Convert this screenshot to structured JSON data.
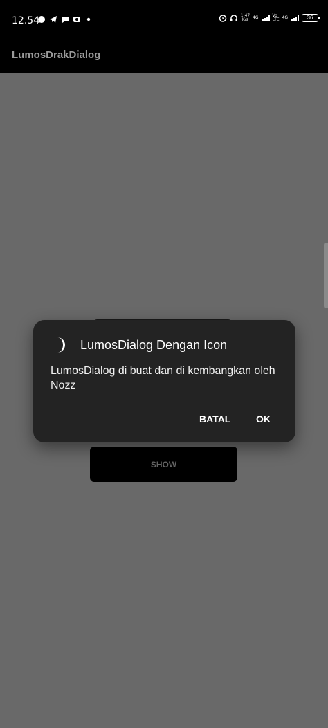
{
  "status_bar": {
    "time": "12.54",
    "net_speed_value": "1,47",
    "net_speed_unit": "K/s",
    "net_type_1": "4G",
    "volte_top": "Vo",
    "volte_bottom": "LTE",
    "net_type_2": "4G",
    "battery": "36"
  },
  "app_bar": {
    "title": "LumosDrakDialog"
  },
  "main": {
    "show_button_label": "SHOW"
  },
  "dialog": {
    "icon": "crescent-moon-icon",
    "title": "LumosDialog Dengan Icon",
    "message": "LumosDialog di buat dan di kembangkan oleh Nozz",
    "cancel_label": "BATAL",
    "ok_label": "OK"
  },
  "colors": {
    "background": "#696969",
    "dialog_bg": "#232323",
    "bar_bg": "#000000",
    "button_bg": "#000000"
  }
}
